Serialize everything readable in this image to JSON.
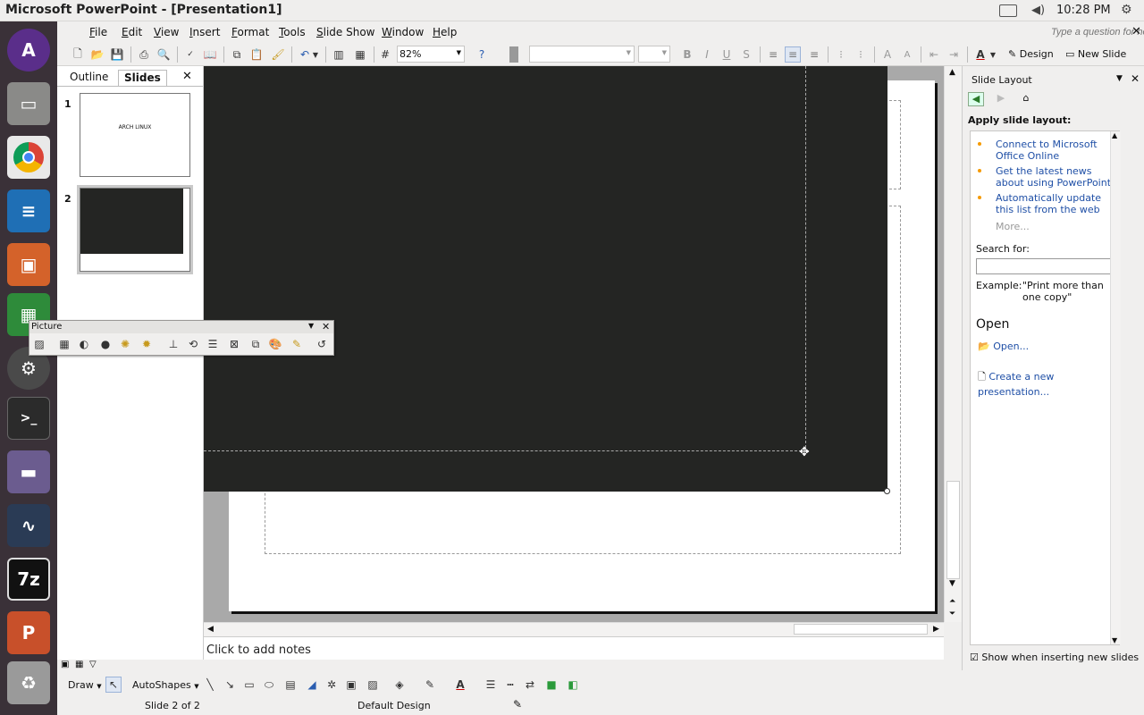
{
  "window": {
    "title": "Microsoft PowerPoint - [Presentation1]"
  },
  "system": {
    "clock": "10:28 PM"
  },
  "menu": [
    "File",
    "Edit",
    "View",
    "Insert",
    "Format",
    "Tools",
    "Slide Show",
    "Window",
    "Help"
  ],
  "help_box": {
    "placeholder": "Type a question for help"
  },
  "toolbar": {
    "zoom": "82%",
    "design_label": "Design",
    "new_slide_label": "New Slide"
  },
  "left_pane": {
    "tabs": [
      "Outline",
      "Slides"
    ],
    "slides": [
      {
        "number": "1",
        "text": "ARCH LINUX"
      },
      {
        "number": "2",
        "text": ""
      }
    ]
  },
  "picture_toolbar": {
    "title": "Picture"
  },
  "notes": {
    "placeholder": "Click to add notes"
  },
  "task_pane": {
    "title": "Slide Layout",
    "heading": "Apply slide layout:",
    "links": [
      "Connect to Microsoft Office Online",
      "Get the latest news about using PowerPoint",
      "Automatically update this list from the web"
    ],
    "more": "More...",
    "search_label": "Search for:",
    "example_label": "Example:",
    "example_text": "\"Print more than one copy\"",
    "open_heading": "Open",
    "open_link": "Open...",
    "create_link": "Create a new presentation...",
    "show_when": "Show when inserting new slides"
  },
  "draw_toolbar": {
    "draw": "Draw",
    "autoshapes": "AutoShapes"
  },
  "status": {
    "slide": "Slide 2 of 2",
    "design": "Default Design"
  }
}
